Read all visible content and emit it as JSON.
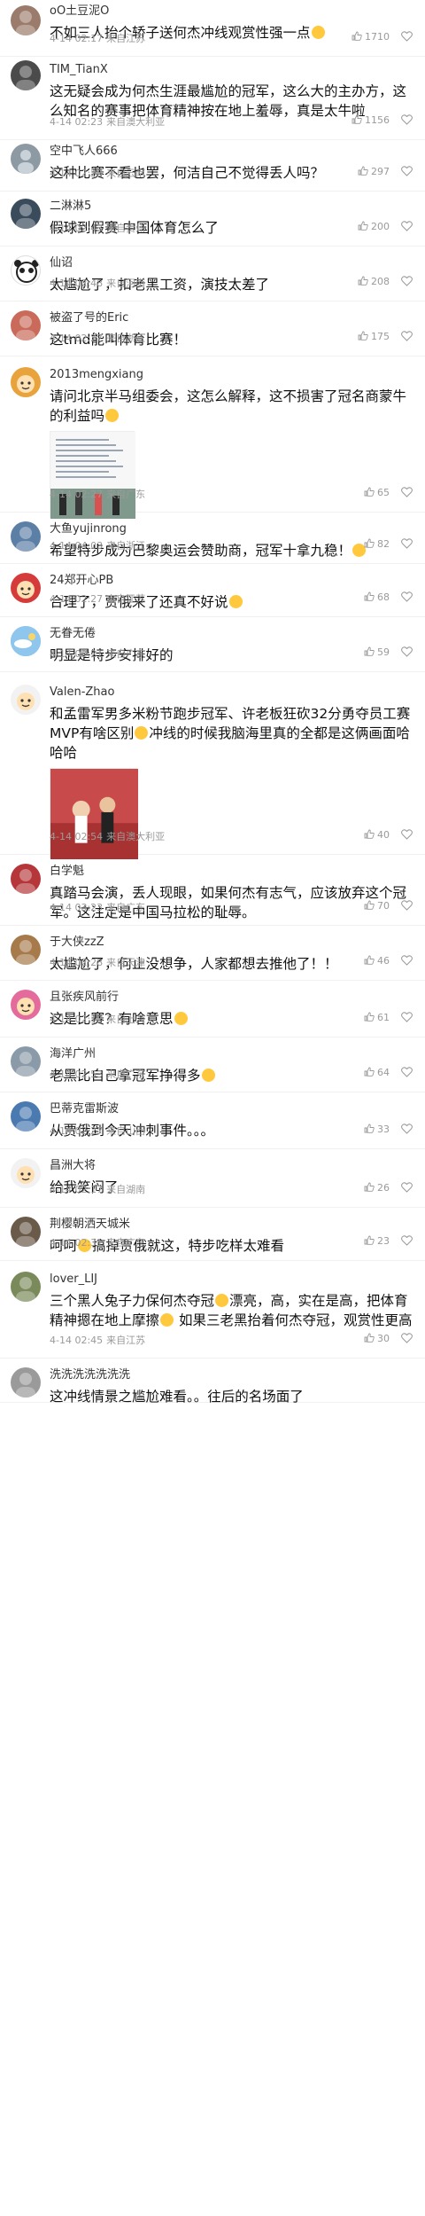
{
  "comments": [
    {
      "name": "oO土豆泥O",
      "text": "不如三人抬个轿子送何杰冲线观赏性强一点",
      "emoji": true,
      "time": "4-14 02:17",
      "loc": "来自江苏",
      "likes": "1710",
      "avatar": "avatar-photo",
      "color": "#9b7b6b"
    },
    {
      "name": "TIM_TianX",
      "text": "这无疑会成为何杰生涯最尴尬的冠军，这么大的主办方，这么知名的赛事把体育精神按在地上羞辱，真是太牛啦",
      "time": "4-14 02:23",
      "loc": "来自澳大利亚",
      "likes": "1156",
      "avatar": "avatar-photo",
      "color": "#4b4b4b"
    },
    {
      "name": "空中飞人666",
      "text": "这种比赛不看也罢，何洁自己不觉得丢人吗？",
      "time": "4-14 02:23",
      "loc": "来自云南",
      "likes": "297",
      "avatar": "avatar-gray",
      "color": "#8d9aa3"
    },
    {
      "name": "二淋淋5",
      "text": "假球到假赛 中国体育怎么了",
      "time": "4-14 02:43",
      "loc": "来自贵州",
      "likes": "200",
      "avatar": "avatar-photo",
      "color": "#3a4c5c"
    },
    {
      "name": "仙诏",
      "text": "太尴尬了，扣老黑工资，演技太差了",
      "time": "4-14 02:48",
      "loc": "来自河南",
      "likes": "208",
      "avatar": "avatar-panda",
      "color": "#222222"
    },
    {
      "name": "被盗了号的Eric",
      "text": "这tmd能叫体育比赛！",
      "time": "4-14 02:27",
      "loc": "来自浙江",
      "likes": "175",
      "avatar": "avatar-photo",
      "color": "#c96a5a"
    },
    {
      "name": "2013mengxiang",
      "text": "请问北京半马组委会，这怎么解释，这不损害了冠名商蒙牛的利益吗",
      "emoji": true,
      "time": "4-14 02:27",
      "loc": "来自广东",
      "likes": "65",
      "avatar": "avatar-cartoon",
      "color": "#e8a33c",
      "image": "screenshot"
    },
    {
      "name": "大鱼yujinrong",
      "text": "希望特步成为巴黎奥运会赞助商，冠军十拿九稳！",
      "emoji": true,
      "time": "4-14 04:03",
      "loc": "来自浙江",
      "likes": "82",
      "avatar": "avatar-photo",
      "color": "#5c7fa6"
    },
    {
      "name": "24郑开心PB",
      "text": "合理了，贾俄来了还真不好说",
      "emoji": true,
      "time": "4-14 02:27",
      "loc": "来自江苏",
      "likes": "68",
      "avatar": "avatar-cartoon",
      "color": "#d63b3b"
    },
    {
      "name": "无眷无倦",
      "text": "明显是特步安排好的",
      "time": "4-14 02:21",
      "loc": "来自广东",
      "likes": "59",
      "avatar": "avatar-sky",
      "color": "#7fb8e0"
    },
    {
      "name": "Valen-Zhao",
      "text": "和孟雷军男多米粉节跑步冠军、许老板狂砍32分勇夺员工赛MVP有啥区别",
      "text2": "冲线的时候我脑海里真的全都是这俩画面哈哈哈",
      "emoji": true,
      "time": "4-14 02:54",
      "loc": "来自澳大利亚",
      "likes": "40",
      "avatar": "avatar-cartoon",
      "color": "#f2f2f2",
      "image": "photo"
    },
    {
      "name": "白学魁",
      "text": "真踏马会演，丢人现眼，如果何杰有志气，应该放弃这个冠军。这注定是中国马拉松的耻辱。",
      "time": "4-14 03:23",
      "loc": "来自广东",
      "likes": "70",
      "avatar": "avatar-photo",
      "color": "#b5373a"
    },
    {
      "name": "于大侠zzZ",
      "text": "太尴尬了，何止没想争，人家都想去推他了！！",
      "time": "4-14 02:28",
      "loc": "来自天津",
      "likes": "46",
      "avatar": "avatar-photo",
      "color": "#a67a4a"
    },
    {
      "name": "且张疾风前行",
      "text": "这是比赛？有啥意思",
      "emoji": true,
      "time": "4-14 02:17",
      "loc": "来自上海",
      "likes": "61",
      "avatar": "avatar-cartoon",
      "color": "#e46c9c"
    },
    {
      "name": "海洋广州",
      "text": "老黑比自己拿冠军挣得多",
      "emoji": true,
      "time": "4-14 02:53",
      "loc": "来自广东",
      "likes": "64",
      "avatar": "avatar-photo",
      "color": "#8a9aa8"
    },
    {
      "name": "巴蒂克雷斯波",
      "text": "从贾俄到今天冲刺事件。。。",
      "time": "4-14 02:27",
      "loc": "来自山西",
      "likes": "33",
      "avatar": "avatar-photo",
      "color": "#4a7ab0"
    },
    {
      "name": "昌洲大将",
      "text": "给我笑闷了",
      "time": "4-14 02:17",
      "loc": "来自湖南",
      "likes": "26",
      "avatar": "avatar-cartoon",
      "color": "#f2f2f2"
    },
    {
      "name": "荆樱朝洒天城米",
      "text": "呵呵",
      "text2": "搞掉贾俄就这，特步吃样太难看",
      "emoji": true,
      "time": "4-14 02:31",
      "loc": "来自广东",
      "likes": "23",
      "avatar": "avatar-photo",
      "color": "#6a5a4a"
    },
    {
      "name": "lover_LIJ",
      "text": "三个黑人兔子力保何杰夺冠",
      "text2": "漂亮，高，实在是高，把体育精神摁在地上摩擦",
      "text3": " 如果三老黑抬着何杰夺冠，观赏性更高",
      "emoji": true,
      "time": "4-14 02:45",
      "loc": "来自江苏",
      "likes": "30",
      "avatar": "avatar-photo",
      "color": "#7a8a5a"
    },
    {
      "name": "洗洗洗洗洗洗洗",
      "text": "这冲线情景之尴尬难看。。往后的名场面了",
      "time": "",
      "loc": "",
      "likes": "",
      "avatar": "avatar-photo",
      "color": "#9a9a9a"
    }
  ],
  "colors": {
    "meta": "#9a9a9a",
    "text": "#111111",
    "border": "#f0f0f0"
  }
}
